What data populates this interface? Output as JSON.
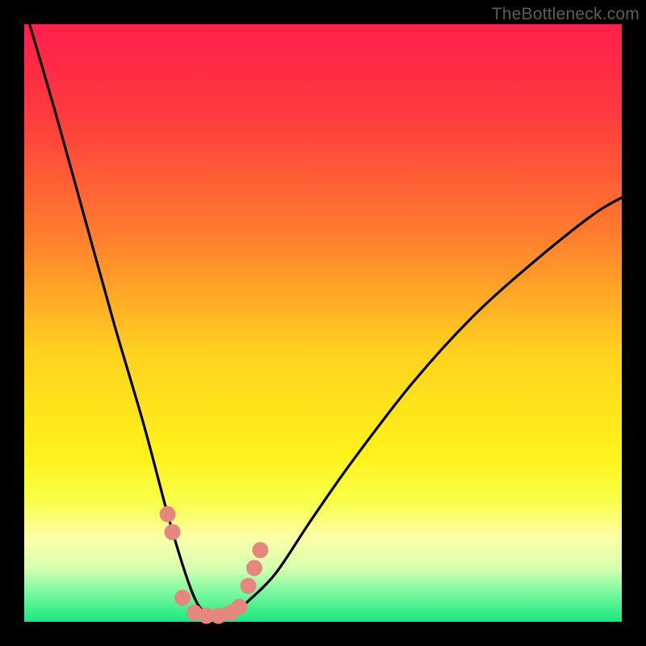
{
  "watermark": {
    "text": "TheBottleneck.com"
  },
  "chart_data": {
    "type": "line",
    "title": "",
    "xlabel": "",
    "ylabel": "",
    "xlim": [
      0,
      100
    ],
    "ylim": [
      0,
      100
    ],
    "series": [
      {
        "name": "bottleneck-curve",
        "x": [
          0,
          5,
          10,
          15,
          20,
          24,
          27,
          29,
          31,
          33,
          35,
          37,
          42,
          48,
          55,
          65,
          75,
          85,
          95,
          100
        ],
        "values": [
          103,
          86,
          68,
          50,
          33,
          18,
          8,
          3,
          1,
          1,
          1,
          3,
          8,
          17,
          27,
          40,
          51,
          60,
          68,
          71
        ]
      }
    ],
    "markers": {
      "name": "highlight-dots",
      "color": "#e5877f",
      "points": [
        {
          "x": 24.0,
          "y": 18.0
        },
        {
          "x": 24.8,
          "y": 15.0
        },
        {
          "x": 26.5,
          "y": 4.0
        },
        {
          "x": 28.5,
          "y": 1.5
        },
        {
          "x": 30.5,
          "y": 1.0
        },
        {
          "x": 32.5,
          "y": 1.0
        },
        {
          "x": 34.5,
          "y": 1.5
        },
        {
          "x": 36.0,
          "y": 2.5
        },
        {
          "x": 37.5,
          "y": 6.0
        },
        {
          "x": 38.5,
          "y": 9.0
        },
        {
          "x": 39.5,
          "y": 12.0
        }
      ]
    },
    "gradient_stops": [
      {
        "offset": 0.0,
        "color": "#ff1f4b"
      },
      {
        "offset": 0.15,
        "color": "#ff3a3e"
      },
      {
        "offset": 0.35,
        "color": "#ff7c2e"
      },
      {
        "offset": 0.55,
        "color": "#ffd21f"
      },
      {
        "offset": 0.72,
        "color": "#fff21a"
      },
      {
        "offset": 0.8,
        "color": "#f8ff4a"
      },
      {
        "offset": 0.86,
        "color": "#fdffa8"
      },
      {
        "offset": 0.91,
        "color": "#d6ffb0"
      },
      {
        "offset": 0.95,
        "color": "#7cf9a0"
      },
      {
        "offset": 1.0,
        "color": "#1be77e"
      }
    ]
  }
}
